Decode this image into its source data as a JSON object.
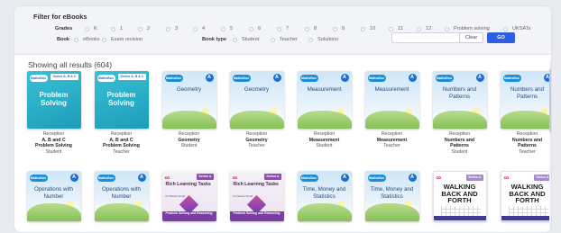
{
  "filter": {
    "title": "Filter for eBooks",
    "grades_label": "Grades",
    "grades": [
      "K",
      "1",
      "2",
      "3",
      "4",
      "5",
      "6",
      "7",
      "8",
      "9",
      "10",
      "11",
      "12",
      "Problem solving",
      "UKSATs"
    ],
    "book_label": "Book",
    "book_options": [
      "eBooks",
      "Exam revision"
    ],
    "book_type_label": "Book type",
    "book_type_options": [
      "Student",
      "Teacher",
      "Solutions"
    ],
    "search_placeholder": "",
    "search_clear_glyph": "×",
    "clear_label": "Clear",
    "go_label": "GO"
  },
  "results_text": "Showing all results (604)",
  "colors": {
    "accent": "#2f5fe0",
    "teal": "#2bb3c8",
    "purple": "#7c3ea2"
  },
  "books_row1": [
    {
      "style": "teal",
      "brand": "MathsBox",
      "series": "Series A, B & C",
      "title": "Problem Solving",
      "line1": "Reception",
      "line2": "A, B and C",
      "line3": "Problem Solving",
      "line4": "Student"
    },
    {
      "style": "teal",
      "brand": "MathsBox",
      "series": "Series A, B & C",
      "title": "Problem Solving",
      "line1": "Reception",
      "line2": "A, B and C",
      "line3": "Problem Solving",
      "line4": "Teacher"
    },
    {
      "style": "sky",
      "brand": "MathsBox",
      "badge": "A",
      "title": "Geometry",
      "line1": "Reception",
      "line2": "Geometry",
      "line3": "Student",
      "line4": ""
    },
    {
      "style": "sky",
      "brand": "MathsBox",
      "badge": "A",
      "title": "Geometry",
      "line1": "Reception",
      "line2": "Geometry",
      "line3": "Teacher",
      "line4": ""
    },
    {
      "style": "sky",
      "brand": "MathsBox",
      "badge": "A",
      "title": "Measurement",
      "line1": "Reception",
      "line2": "Measurement",
      "line3": "Student",
      "line4": ""
    },
    {
      "style": "sky",
      "brand": "MathsBox",
      "badge": "A",
      "title": "Measurement",
      "line1": "Reception",
      "line2": "Measurement",
      "line3": "Teacher",
      "line4": ""
    },
    {
      "style": "sky",
      "brand": "MathsBox",
      "badge": "A",
      "title": "Numbers and Patterns",
      "line1": "Reception",
      "line2": "Numbers and",
      "line3": "Patterns",
      "line4": "Student"
    },
    {
      "style": "sky",
      "brand": "MathsBox",
      "badge": "A",
      "title": "Numbers and Patterns",
      "line1": "Reception",
      "line2": "Numbers and",
      "line3": "Patterns",
      "line4": "Teacher"
    }
  ],
  "books_row2": [
    {
      "style": "sky",
      "brand": "MathsBox",
      "badge": "A",
      "title": "Operations with Number"
    },
    {
      "style": "sky",
      "brand": "MathsBox",
      "badge": "A",
      "title": "Operations with Number"
    },
    {
      "style": "rlt",
      "series": "Series A",
      "title": "Rich Learning Tasks",
      "sub": "Dr Marian Small",
      "band": "Problem Solving and Reasoning"
    },
    {
      "style": "rlt",
      "series": "Series A",
      "title": "Rich Learning Tasks",
      "sub": "Dr Marian Small",
      "band": "Problem Solving and Reasoning"
    },
    {
      "style": "sky",
      "brand": "MathsBox",
      "badge": "A",
      "title": "Time, Money and Statistics"
    },
    {
      "style": "sky",
      "brand": "MathsBox",
      "badge": "A",
      "title": "Time, Money and Statistics"
    },
    {
      "style": "wb",
      "series": "Series A",
      "title": "WALKING BACK AND FORTH"
    },
    {
      "style": "wb",
      "series": "Series A",
      "title": "WALKING BACK AND FORTH"
    }
  ]
}
